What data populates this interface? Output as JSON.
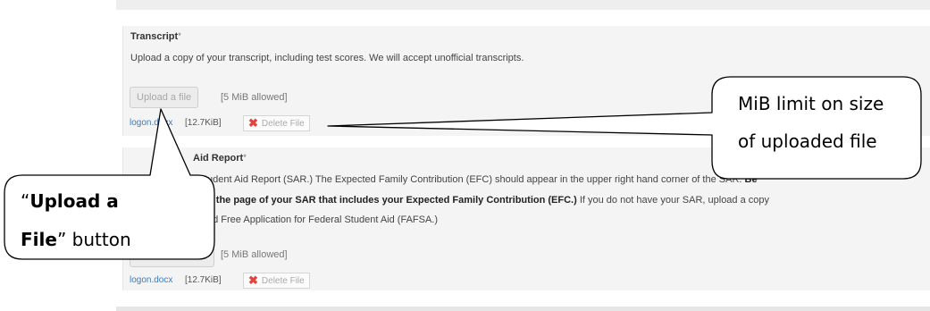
{
  "transcript": {
    "label": "Transcript",
    "required_mark": "*",
    "description": "Upload a copy of your transcript, including test scores. We will accept unofficial transcripts.",
    "upload_label": "Upload a file",
    "limit": "[5 MiB allowed]",
    "file_name": "logon.docx",
    "file_size": "[12.7KiB]",
    "delete_label": "Delete File"
  },
  "sar": {
    "label_visible": "Aid Report",
    "required_mark": "*",
    "line1": "tudent Aid Report (SAR.) The Expected Family Contribution (EFC) should appear in the upper right hand corner of the SAR.",
    "line1_bold": "Be",
    "line2_bold": "d the page of your SAR that includes your Expected Family Contribution (EFC.)",
    "line2": " If you do not have your SAR, upload a copy",
    "line3": "ed Free Application for Federal Student Aid (FAFSA.)",
    "limit": "[5 MiB allowed]",
    "file_name": "logon.docx",
    "file_size": "[12.7KiB]",
    "delete_label": "Delete File"
  },
  "callouts": {
    "mib": {
      "line1": "MiB limit on size",
      "line2": "of uploaded file"
    },
    "upload": {
      "quote_open": "“",
      "bold1": "Upload a",
      "bold2": "File",
      "rest2": "” button"
    }
  },
  "icons": {
    "delete": "x-icon"
  },
  "colors": {
    "link": "#3a7bbf",
    "delete_x": "#e0443e"
  }
}
